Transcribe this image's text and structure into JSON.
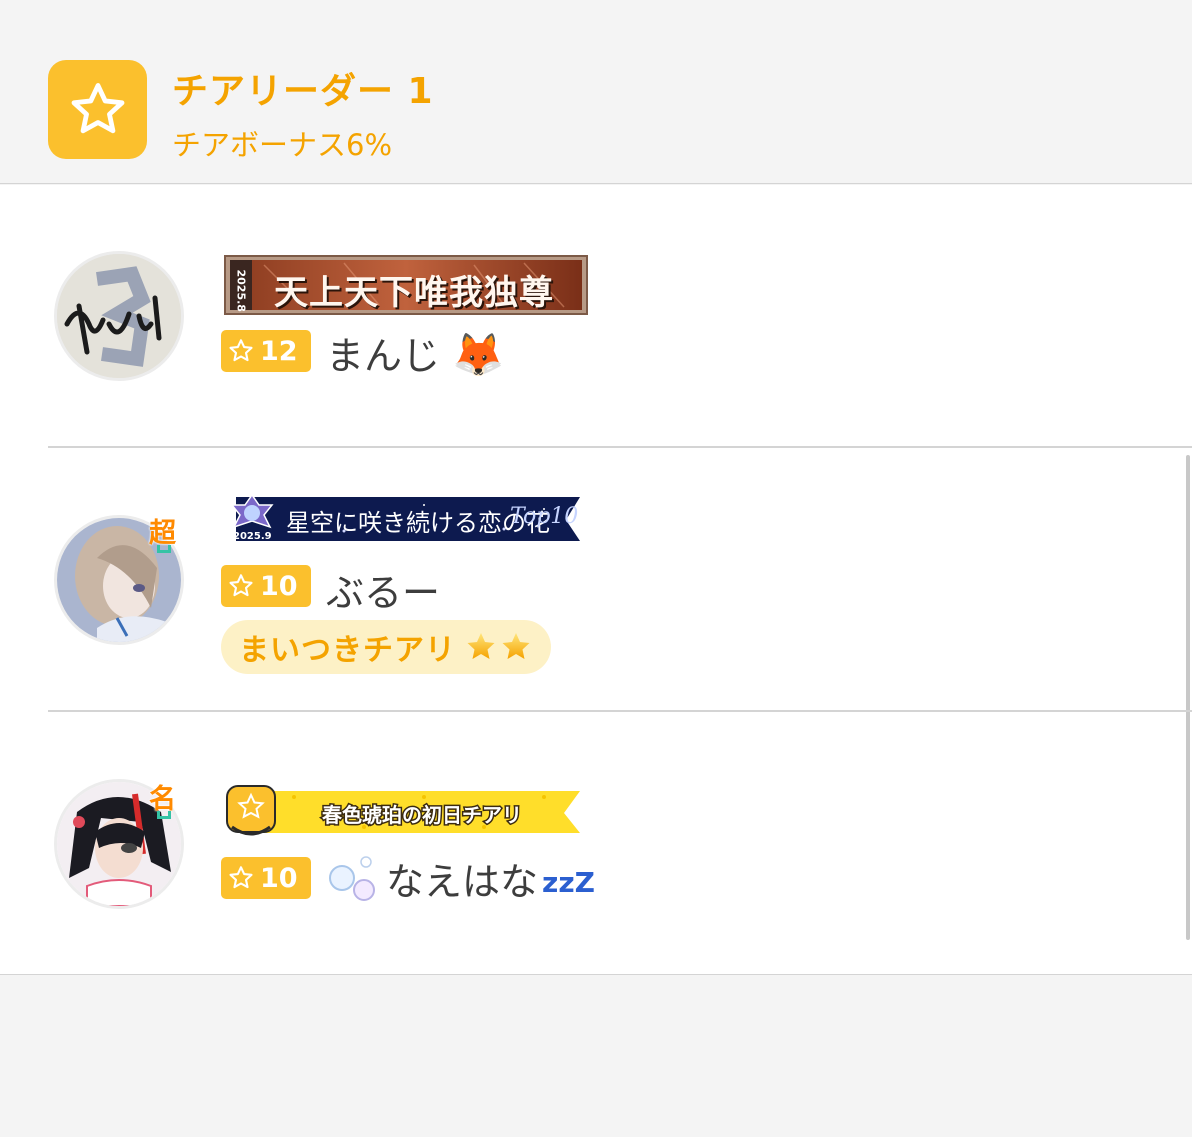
{
  "header": {
    "icon": "star-icon",
    "title": "チアリーダー 1",
    "subtitle": "チアボーナス6%"
  },
  "colors": {
    "accent": "#fbc02d",
    "accent_text": "#f4a300",
    "pill_bg": "#fdf1c6",
    "badge_orange": "#ff8a00"
  },
  "members": [
    {
      "banner_text": "天上天下唯我独尊",
      "banner_date": "2025.8",
      "level": "12",
      "name": "まんじ",
      "name_emoji": "🦊"
    },
    {
      "badge": "超",
      "banner_text": "星空に咲き続ける恋の花",
      "banner_rank": "Top10",
      "banner_date": "2025.9",
      "level": "10",
      "name": "ぶるー",
      "tag": "まいつきチアリ"
    },
    {
      "badge": "名",
      "banner_text": "春色琥珀の初日チアリ",
      "level": "10",
      "name": "なえはな",
      "name_suffix": "zzZ"
    }
  ]
}
